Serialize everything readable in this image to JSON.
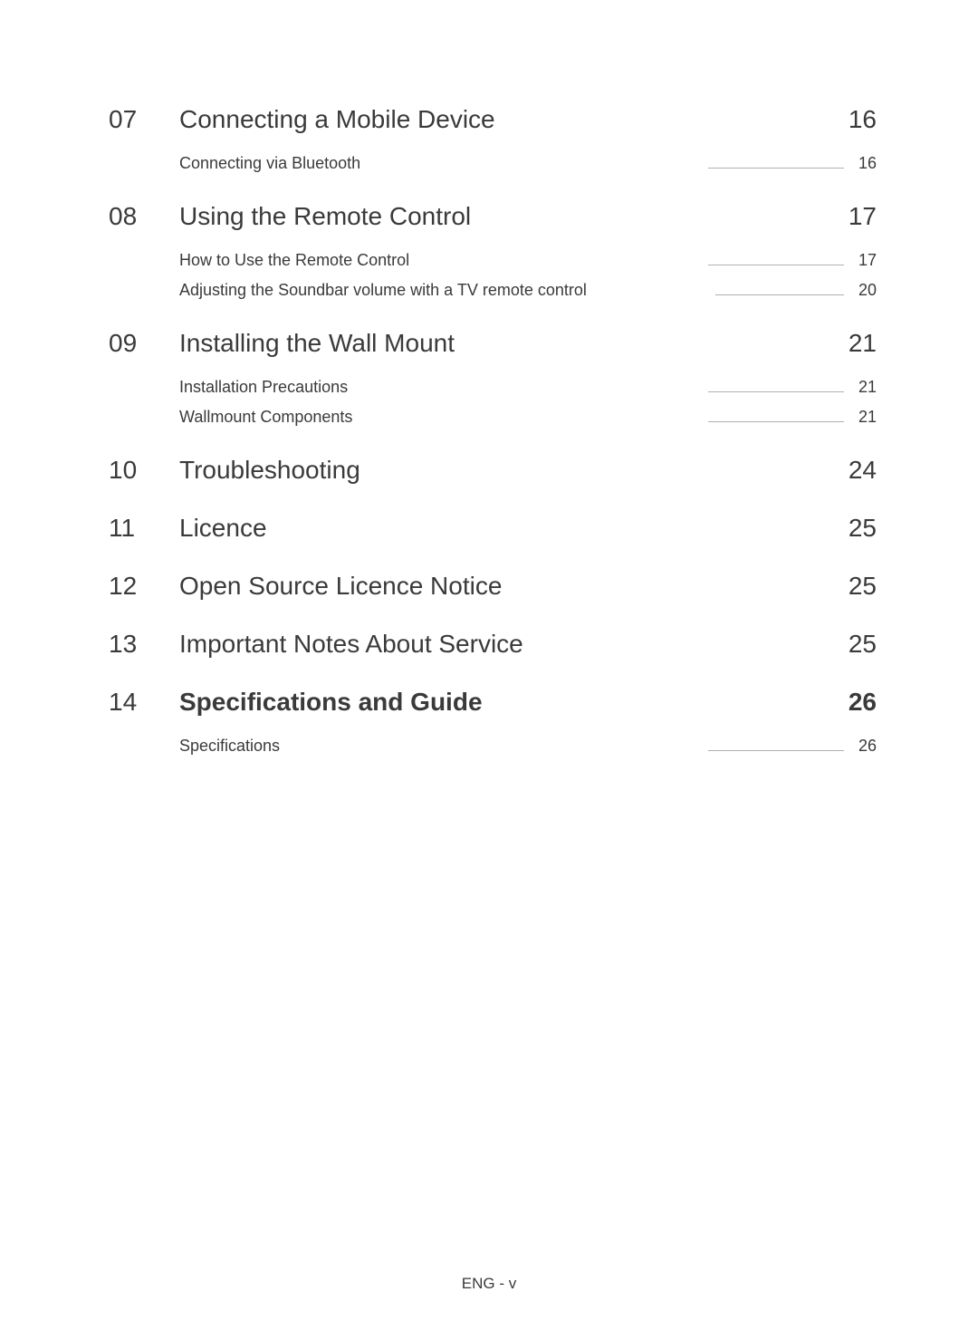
{
  "toc": {
    "sections": [
      {
        "number": "07",
        "title": "Connecting a Mobile Device",
        "page": "16",
        "bold": false,
        "subs": [
          {
            "title": "Connecting via Bluetooth",
            "page": "16"
          }
        ]
      },
      {
        "number": "08",
        "title": "Using the Remote Control",
        "page": "17",
        "bold": false,
        "subs": [
          {
            "title": "How to Use the Remote Control",
            "page": "17"
          },
          {
            "title": "Adjusting the Soundbar volume with a TV remote control",
            "page": "20"
          }
        ]
      },
      {
        "number": "09",
        "title": "Installing the Wall Mount",
        "page": "21",
        "bold": false,
        "subs": [
          {
            "title": "Installation Precautions",
            "page": "21"
          },
          {
            "title": "Wallmount Components",
            "page": "21"
          }
        ]
      },
      {
        "number": "10",
        "title": "Troubleshooting",
        "page": "24",
        "bold": false,
        "subs": []
      },
      {
        "number": "11",
        "title": "Licence",
        "page": "25",
        "bold": false,
        "subs": []
      },
      {
        "number": "12",
        "title": "Open Source Licence Notice",
        "page": "25",
        "bold": false,
        "subs": []
      },
      {
        "number": "13",
        "title": "Important Notes About Service",
        "page": "25",
        "bold": false,
        "subs": []
      },
      {
        "number": "14",
        "title": "Specifications and Guide",
        "page": "26",
        "bold": true,
        "subs": [
          {
            "title": "Specifications",
            "page": "26"
          }
        ]
      }
    ]
  },
  "footer": "ENG - v"
}
